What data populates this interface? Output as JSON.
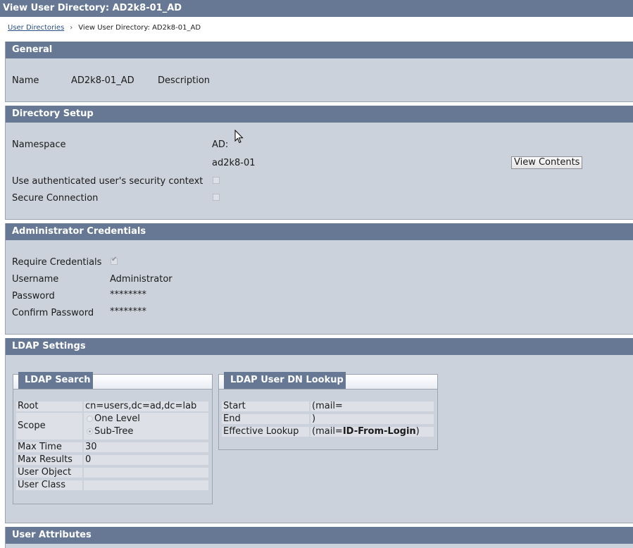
{
  "window": {
    "title": "View User Directory: AD2k8-01_AD"
  },
  "breadcrumb": {
    "link": "User Directories",
    "separator": "›",
    "current": "View User Directory: AD2k8-01_AD"
  },
  "general": {
    "header": "General",
    "name_label": "Name",
    "name_value": "AD2k8-01_AD",
    "description_label": "Description",
    "description_value": ""
  },
  "directory_setup": {
    "header": "Directory Setup",
    "namespace_label": "Namespace",
    "namespace_value": "AD:",
    "directory_value": "ad2k8-01",
    "view_contents_label": "View Contents",
    "use_auth_context_label": "Use authenticated user's security context",
    "use_auth_context_checked": false,
    "secure_connection_label": "Secure Connection",
    "secure_connection_checked": false
  },
  "admin_credentials": {
    "header": "Administrator Credentials",
    "require_label": "Require Credentials",
    "require_checked": true,
    "username_label": "Username",
    "username_value": "Administrator",
    "password_label": "Password",
    "password_value": "********",
    "confirm_label": "Confirm Password",
    "confirm_value": "********"
  },
  "ldap_settings": {
    "header": "LDAP Settings",
    "search": {
      "title": "LDAP Search",
      "root_label": "Root",
      "root_value": "cn=users,dc=ad,dc=lab",
      "scope_label": "Scope",
      "scope_options": [
        "One Level",
        "Sub-Tree"
      ],
      "scope_selected": "Sub-Tree",
      "max_time_label": "Max Time",
      "max_time_value": "30",
      "max_results_label": "Max Results",
      "max_results_value": "0",
      "user_object_label": "User Object",
      "user_object_value": "",
      "user_class_label": "User Class",
      "user_class_value": ""
    },
    "dn_lookup": {
      "title": "LDAP User DN Lookup",
      "start_label": "Start",
      "start_value": "(mail=",
      "end_label": "End",
      "end_value": ")",
      "effective_label": "Effective Lookup",
      "effective_prefix": "(mail=",
      "effective_bold": "ID-From-Login",
      "effective_suffix": ")"
    }
  },
  "user_attributes": {
    "header": "User Attributes"
  },
  "colors": {
    "header_bg": "#667894",
    "panel_bg": "#ccd2dc",
    "cell_bg": "#dde1e7"
  }
}
